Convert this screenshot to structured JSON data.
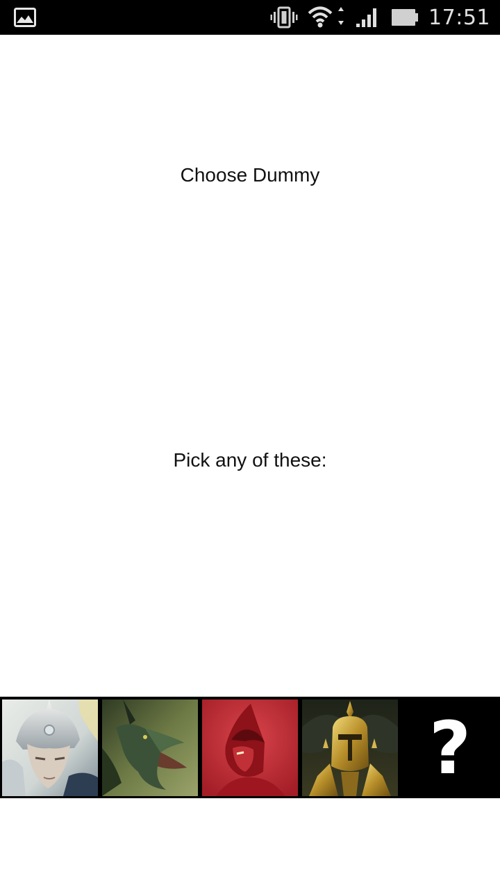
{
  "status_bar": {
    "time": "17:51",
    "left_icon": "image-icon",
    "icons": [
      "vibrate-icon",
      "wifi-icon",
      "signal-icon",
      "battery-icon"
    ]
  },
  "main": {
    "title": "Choose Dummy",
    "subtitle": "Pick any of these:"
  },
  "picker": {
    "items": [
      {
        "icon": "silver-elf-warrior-portrait"
      },
      {
        "icon": "green-dragon-portrait"
      },
      {
        "icon": "red-demon-portrait"
      },
      {
        "icon": "golden-knight-portrait"
      },
      {
        "icon": "question-mark-icon",
        "label": "?"
      }
    ]
  }
}
